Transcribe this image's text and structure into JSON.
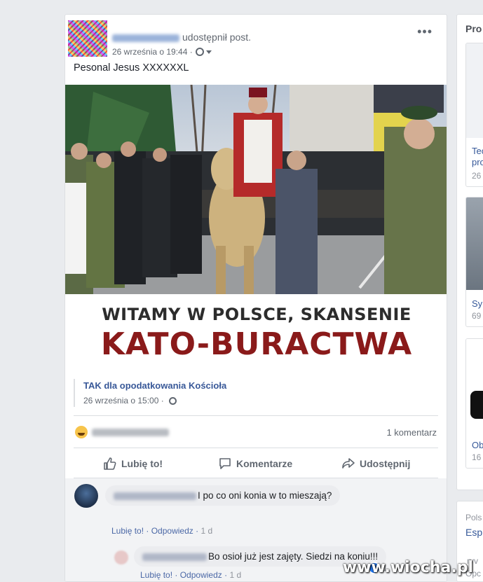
{
  "post": {
    "action_text": "udostępnił post.",
    "timestamp": "26 września o 19:44",
    "menu_label": "•••",
    "text": "Pesonal Jesus XXXXXXL",
    "image_caption_line1": "WITAMY W POLSCE, SKANSENIE",
    "image_caption_line2": "KATO-BURACTWA"
  },
  "shared": {
    "title": "TAK dla opodatkowania Kościoła",
    "timestamp": "26 września o 15:00"
  },
  "stats": {
    "comment_count": "1 komentarz"
  },
  "actions": {
    "like": "Lubię to!",
    "comment": "Komentarze",
    "share": "Udostępnij"
  },
  "comments": [
    {
      "text": "I po co oni konia w to mieszają?",
      "like": "Lubię to!",
      "reply": "Odpowiedz",
      "time": "1 d"
    },
    {
      "text": "Bo osioł już jest zajęty. Siedzi na koniu!!!",
      "like": "Lubię to!",
      "reply": "Odpowiedz",
      "time": "1 d",
      "reaction_count": "1"
    }
  ],
  "sidebar": {
    "title": "Pro",
    "cards": [
      {
        "link": "Tec",
        "link2": "pro",
        "meta": "26"
      },
      {
        "link": "Sy",
        "meta": "69"
      },
      {
        "link": "Ob",
        "meta": "16"
      }
    ],
    "footer_text": "Pols",
    "footer_link": "Esp",
    "footer_extra": "ryv",
    "footer_extra2": "Opc"
  },
  "watermark": "www.wiocha.pl",
  "colors": {
    "link": "#385898",
    "caption_red": "#8a1a1a",
    "page_bg": "#e9ebee"
  }
}
